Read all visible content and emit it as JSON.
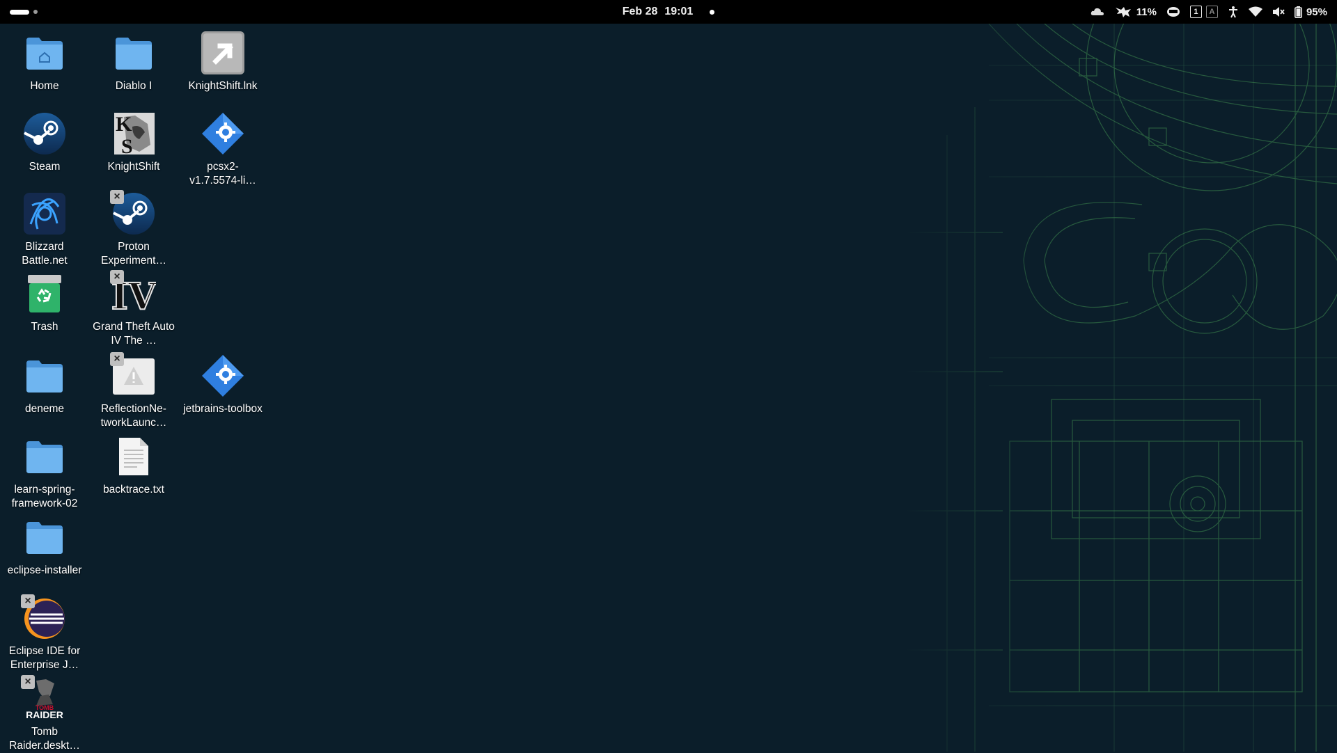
{
  "topbar": {
    "date": "Feb 28",
    "time": "19:01",
    "cpu_percent": "11%",
    "workspace_number": "1",
    "workspace_letter": "A",
    "battery_percent": "95%"
  },
  "desktop": {
    "icons": [
      {
        "label": "Home",
        "icon": "home-folder-icon"
      },
      {
        "label": "Diablo I",
        "icon": "folder-icon"
      },
      {
        "label": "KnightShift.lnk",
        "icon": "shortcut-link-icon"
      },
      {
        "label": "Steam",
        "icon": "steam-icon"
      },
      {
        "label": "KnightShift",
        "icon": "knightshift-icon"
      },
      {
        "label": "pcsx2-v1.7.5574-li…",
        "icon": "pcsx2-icon"
      },
      {
        "label": "Blizzard Battle.net",
        "icon": "battlenet-icon"
      },
      {
        "label": "Proton Experiment…",
        "icon": "steam-icon"
      },
      {
        "label": "Trash",
        "icon": "trash-icon"
      },
      {
        "label": "Grand Theft Auto IV The …",
        "icon": "gta-iv-icon"
      },
      {
        "label": "deneme",
        "icon": "folder-icon"
      },
      {
        "label": "ReflectionNe-tworkLaunc…",
        "icon": "warning-file-icon"
      },
      {
        "label": "jetbrains-toolbox",
        "icon": "jetbrains-toolbox-icon"
      },
      {
        "label": "learn-spring-framework-02",
        "icon": "folder-icon"
      },
      {
        "label": "backtrace.txt",
        "icon": "text-file-icon"
      },
      {
        "label": "eclipse-installer",
        "icon": "folder-icon"
      },
      {
        "label": "Eclipse IDE for Enterprise J…",
        "icon": "eclipse-icon"
      },
      {
        "label": "Tomb Raider.deskt…",
        "icon": "tomb-raider-icon"
      }
    ]
  },
  "colors": {
    "topbar_bg": "#000000",
    "desktop_bg": "#0b1e2a",
    "folder_blue": "#5aa7e8",
    "blueprint_green": "#3f7a4a"
  }
}
